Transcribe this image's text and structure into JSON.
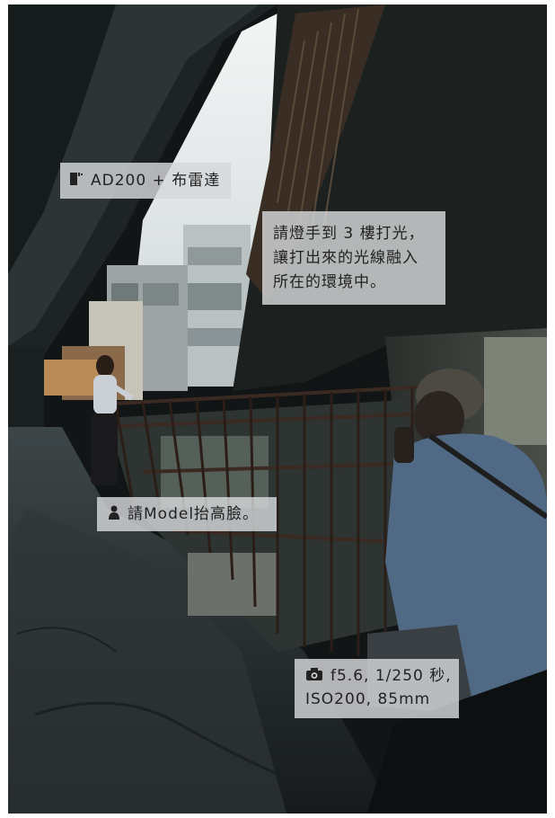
{
  "captions": {
    "light": {
      "text": "AD200 + 布雷達",
      "icon": "flash-light-icon"
    },
    "assistant": {
      "lines": [
        "請燈手到 3 樓打光，",
        "讓打出來的光線融入",
        "所在的環境中。"
      ]
    },
    "model": {
      "text": "請Model抬高臉。",
      "icon": "person-icon"
    },
    "camera": {
      "lines": [
        "f5.6, 1/250 秒,",
        "ISO200, 85mm"
      ],
      "icon": "camera-icon"
    }
  },
  "colors": {
    "caption_bg": "#d6d8da",
    "caption_text": "#222222",
    "photo_dark": "#0e1214",
    "sky": "#e9ecec"
  }
}
